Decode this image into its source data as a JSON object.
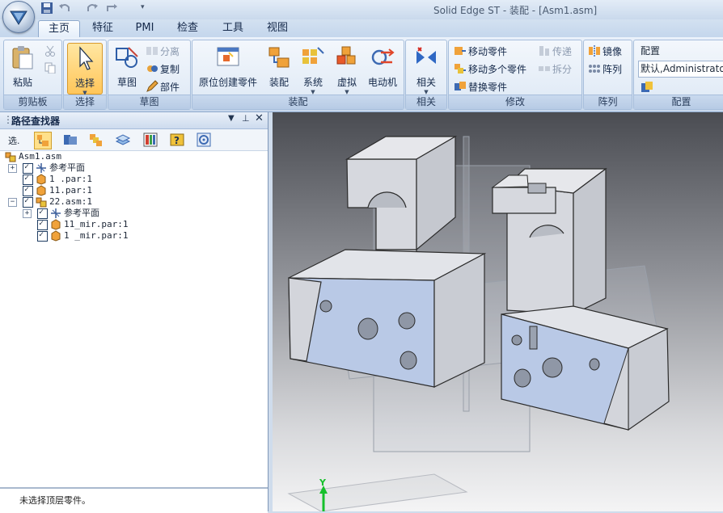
{
  "window": {
    "title": "Solid Edge ST - 装配 - [Asm1.asm]"
  },
  "tabs": [
    {
      "label": "主页",
      "active": true
    },
    {
      "label": "特征"
    },
    {
      "label": "PMI"
    },
    {
      "label": "检查"
    },
    {
      "label": "工具"
    },
    {
      "label": "视图"
    }
  ],
  "ribbon": {
    "clipboard": {
      "label": "剪贴板",
      "paste": "粘贴"
    },
    "select": {
      "label": "选择",
      "select": "选择"
    },
    "sketch": {
      "label": "草图",
      "sketch": "草图",
      "split": "分离",
      "copy": "复制",
      "part": "部件"
    },
    "assemble": {
      "label": "装配",
      "create_in_place": "原位创建零件",
      "assemble": "装配",
      "system": "系统",
      "virtual": "虚拟",
      "motor": "电动机"
    },
    "relate": {
      "label": "相关",
      "relate": "相关"
    },
    "modify": {
      "label": "修改",
      "move_part": "移动零件",
      "move_parts": "移动多个零件",
      "replace_part": "替换零件",
      "transfer": "传递",
      "disperse": "拆分"
    },
    "pattern": {
      "label": "阵列",
      "mirror": "镜像",
      "pattern": "阵列"
    },
    "config": {
      "label": "配置",
      "title": "配置",
      "value": "默认,Administrator"
    }
  },
  "pathfinder": {
    "title": "路径查找器",
    "select_tool": "选.",
    "tree": [
      {
        "text": "Asm1.asm",
        "indent": 0,
        "icon": "assembly-icon",
        "checkbox": false,
        "expander": ""
      },
      {
        "text": "参考平面",
        "indent": 1,
        "icon": "reference-plane-icon",
        "checkbox": true,
        "expander": "+"
      },
      {
        "text": "1 .par:1",
        "indent": 1,
        "icon": "part-icon",
        "checkbox": true,
        "expander": ""
      },
      {
        "text": "11.par:1",
        "indent": 1,
        "icon": "part-icon",
        "checkbox": true,
        "expander": ""
      },
      {
        "text": "22.asm:1",
        "indent": 1,
        "icon": "assembly-icon",
        "checkbox": true,
        "expander": "−"
      },
      {
        "text": "参考平面",
        "indent": 2,
        "icon": "reference-plane-icon",
        "checkbox": true,
        "expander": "+"
      },
      {
        "text": "11_mir.par:1",
        "indent": 2,
        "icon": "part-icon",
        "checkbox": true,
        "expander": ""
      },
      {
        "text": "1 _mir.par:1",
        "indent": 2,
        "icon": "part-icon",
        "checkbox": true,
        "expander": ""
      }
    ],
    "status": "未选择顶层零件。"
  },
  "viewport": {
    "axis_label": "Y"
  },
  "colors": {
    "part_face": "#d8dae2",
    "selected_face": "#b9c9e6",
    "accent": "#ffc65a"
  }
}
